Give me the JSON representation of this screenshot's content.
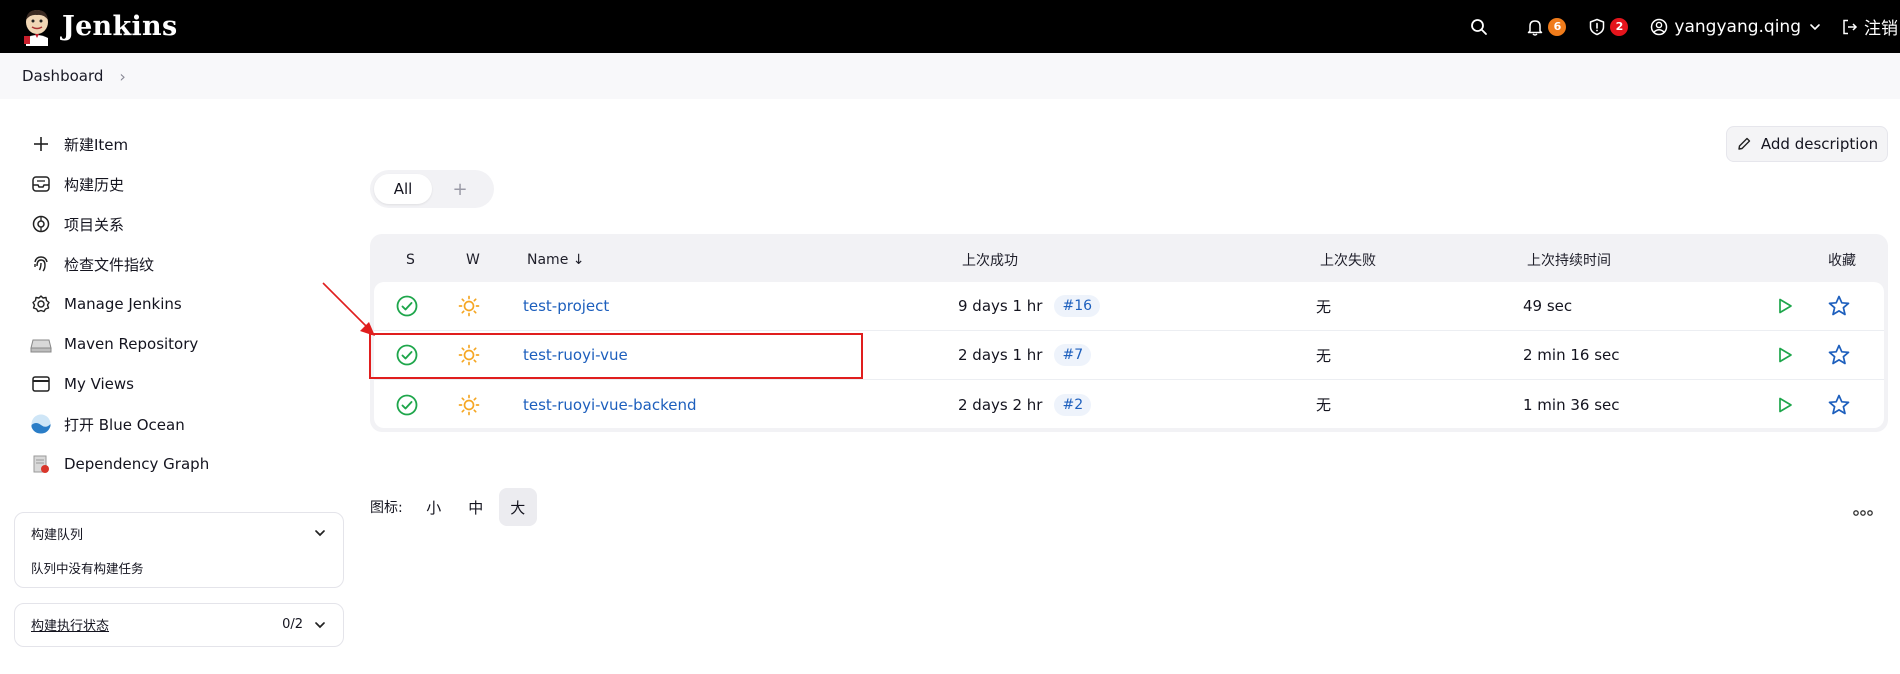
{
  "header": {
    "app_name": "Jenkins",
    "notifications_count": "6",
    "security_count": "2",
    "username": "yangyang.qing",
    "logout_label": "注销",
    "notify_color": "#f07c1b",
    "security_color": "#e5141c"
  },
  "breadcrumb": {
    "root": "Dashboard"
  },
  "sidebar": {
    "items": [
      {
        "label": "新建Item",
        "icon": "plus-icon"
      },
      {
        "label": "构建历史",
        "icon": "inbox-icon"
      },
      {
        "label": "项目关系",
        "icon": "relationship-icon"
      },
      {
        "label": "检查文件指纹",
        "icon": "fingerprint-icon"
      },
      {
        "label": "Manage Jenkins",
        "icon": "gear-icon"
      },
      {
        "label": "Maven Repository",
        "icon": "drive-icon"
      },
      {
        "label": "My Views",
        "icon": "window-icon"
      },
      {
        "label": "打开 Blue Ocean",
        "icon": "blue-ocean-icon"
      },
      {
        "label": "Dependency Graph",
        "icon": "dependency-graph-icon"
      }
    ],
    "queue": {
      "title": "构建队列",
      "empty_text": "队列中没有构建任务"
    },
    "executor": {
      "title": "构建执行状态",
      "count": "0/2"
    }
  },
  "main": {
    "add_description_label": "Add description",
    "tabs": {
      "all": "All",
      "add": "+"
    },
    "table": {
      "headers": {
        "s": "S",
        "w": "W",
        "name": "Name ↓",
        "last_success": "上次成功",
        "last_failure": "上次失败",
        "last_duration": "上次持续时间",
        "favorite": "收藏"
      },
      "rows": [
        {
          "name": "test-project",
          "last_success": "9 days 1 hr",
          "build": "#16",
          "last_failure": "无",
          "duration": "49 sec"
        },
        {
          "name": "test-ruoyi-vue",
          "last_success": "2 days 1 hr",
          "build": "#7",
          "last_failure": "无",
          "duration": "2 min 16 sec"
        },
        {
          "name": "test-ruoyi-vue-backend",
          "last_success": "2 days 2 hr",
          "build": "#2",
          "last_failure": "无",
          "duration": "1 min 36 sec"
        }
      ]
    },
    "icon_size": {
      "label": "图标:",
      "small": "小",
      "medium": "中",
      "large": "大"
    }
  },
  "colors": {
    "success": "#1ea64b",
    "sunny": "#f5a623",
    "link": "#1d5fbd",
    "annotation": "#e01e1e"
  }
}
